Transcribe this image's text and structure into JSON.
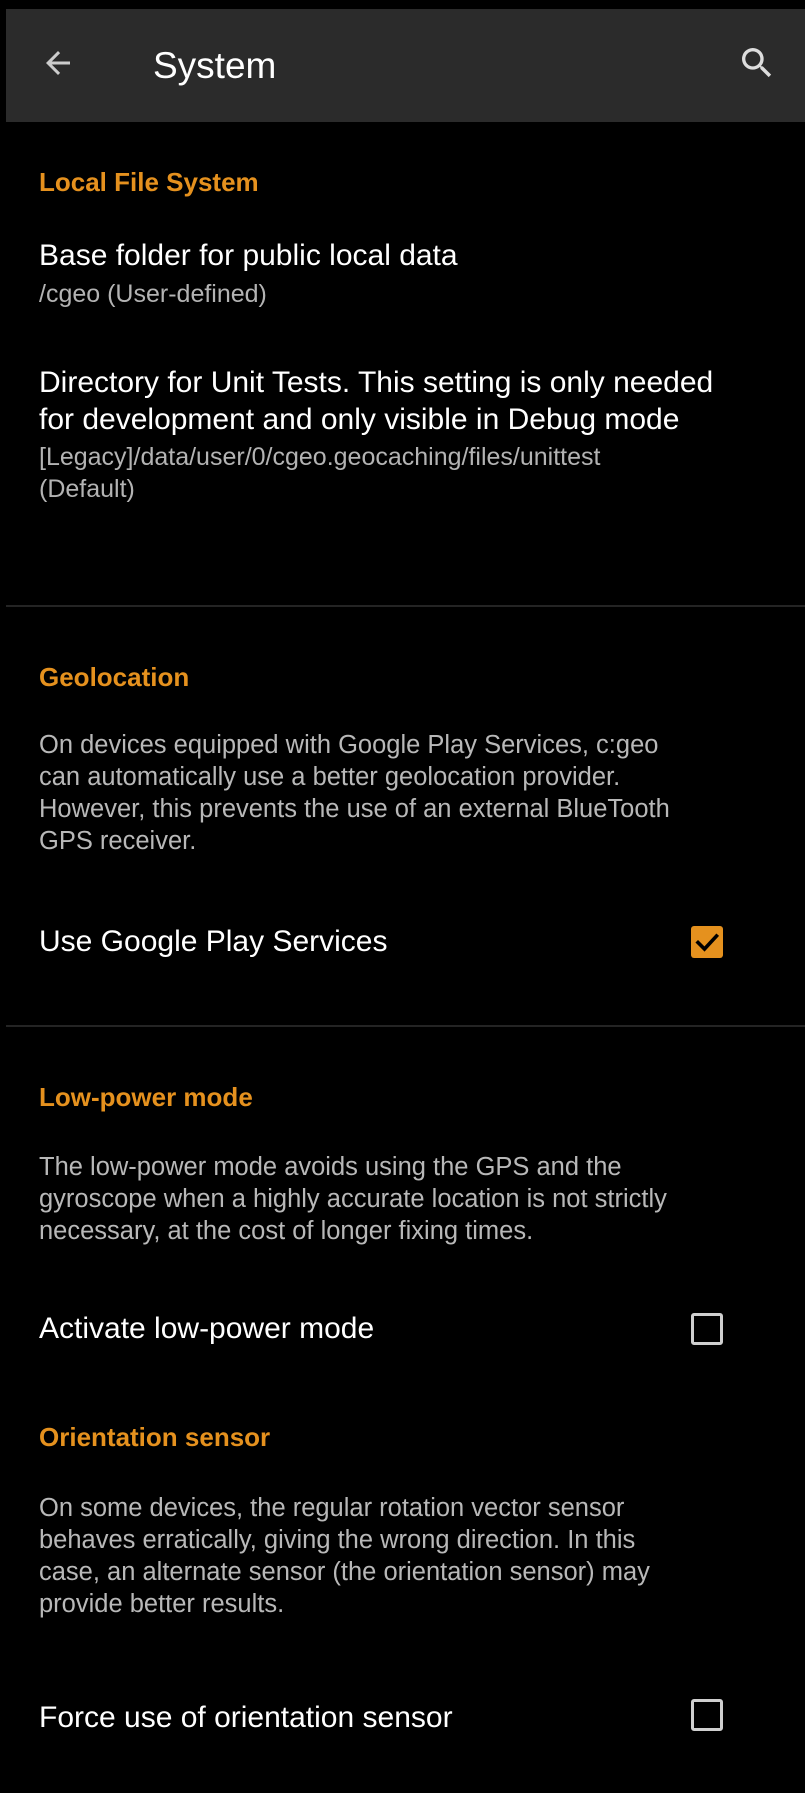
{
  "toolbar": {
    "title": "System",
    "back_icon": "arrow-left-icon",
    "search_icon": "search-icon"
  },
  "colors": {
    "accent": "#e5911e",
    "toolbar_bg": "#2b2b2b",
    "background": "#000000",
    "summary_text": "#b3b3b3"
  },
  "sections": {
    "local_file_system": {
      "title": "Local File System",
      "base_folder": {
        "title": "Base folder for public local data",
        "summary": "/cgeo (User-defined)"
      },
      "unit_tests_dir": {
        "title_line1": "Directory for Unit Tests. This setting is only needed",
        "title_line2": "for development and only visible in Debug mode",
        "summary_line1": "[Legacy]/data/user/0/cgeo.geocaching/files/unittest",
        "summary_line2": "(Default)"
      }
    },
    "geolocation": {
      "title": "Geolocation",
      "info_lines": [
        "On devices equipped with Google Play Services, c:geo",
        "can automatically use a better geolocation provider.",
        "However, this prevents the use of an external BlueTooth",
        "GPS receiver."
      ],
      "play_services": {
        "label": "Use Google Play Services",
        "checked": true
      }
    },
    "low_power": {
      "title": "Low-power mode",
      "info_lines": [
        "The low-power mode avoids using the GPS and the",
        "gyroscope when a highly accurate location is not strictly",
        "necessary, at the cost of longer fixing times."
      ],
      "activate": {
        "label": "Activate low-power mode",
        "checked": false
      }
    },
    "orientation": {
      "title": "Orientation sensor",
      "info_lines": [
        "On some devices, the regular rotation vector sensor",
        "behaves erratically, giving the wrong direction. In this",
        "case, an alternate sensor (the orientation sensor) may",
        "provide better results."
      ],
      "force": {
        "label": "Force use of orientation sensor",
        "checked": false
      }
    }
  }
}
